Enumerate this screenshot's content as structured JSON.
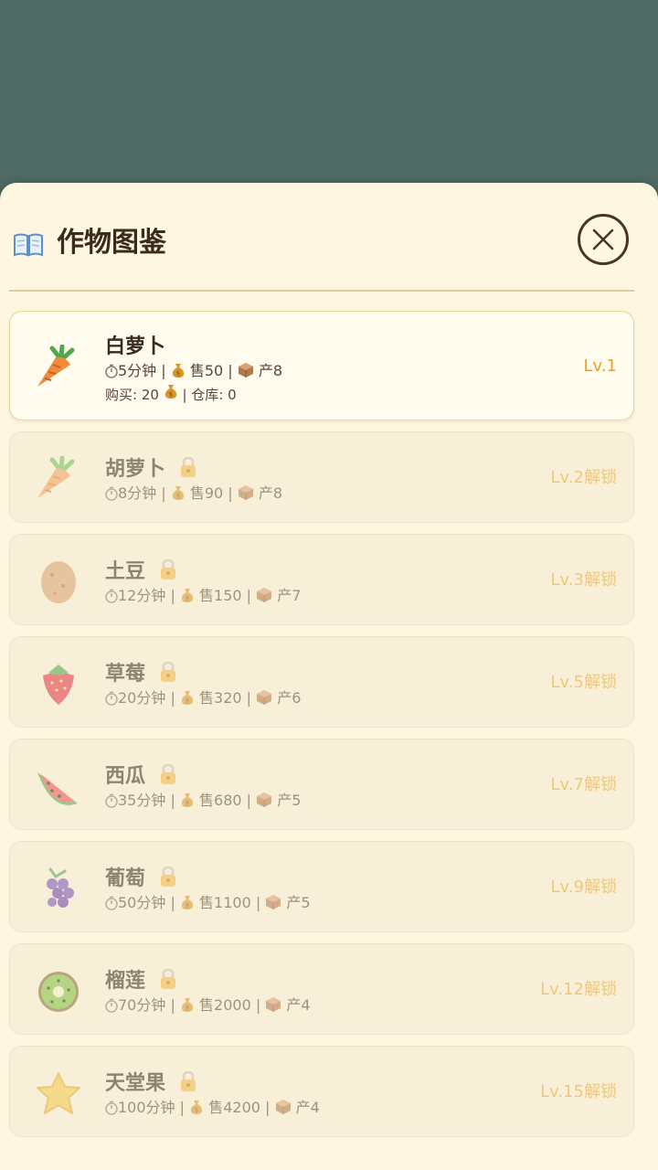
{
  "header": {
    "title": "作物图鉴"
  },
  "icons": {
    "title": "book-icon",
    "close": "close-icon",
    "lock": "lock-icon",
    "timer": "timer-icon",
    "money": "money-bag-icon",
    "box": "box-icon"
  },
  "colors": {
    "backdrop": "#4f6b64",
    "sheet": "#fdf6e1",
    "level": "#e3a21f"
  },
  "crops": [
    {
      "name": "白萝卜",
      "time": "5分钟",
      "sell": "售50",
      "yield": "产8",
      "buy": "购买: 20",
      "stock": "| 仓库: 0",
      "level": "Lv.1",
      "locked": false,
      "icon": "white-radish-icon"
    },
    {
      "name": "胡萝卜",
      "time": "8分钟",
      "sell": "售90",
      "yield": "产8",
      "level": "Lv.2解锁",
      "locked": true,
      "icon": "carrot-icon"
    },
    {
      "name": "土豆",
      "time": "12分钟",
      "sell": "售150",
      "yield": "产7",
      "level": "Lv.3解锁",
      "locked": true,
      "icon": "potato-icon"
    },
    {
      "name": "草莓",
      "time": "20分钟",
      "sell": "售320",
      "yield": "产6",
      "level": "Lv.5解锁",
      "locked": true,
      "icon": "strawberry-icon"
    },
    {
      "name": "西瓜",
      "time": "35分钟",
      "sell": "售680",
      "yield": "产5",
      "level": "Lv.7解锁",
      "locked": true,
      "icon": "watermelon-icon"
    },
    {
      "name": "葡萄",
      "time": "50分钟",
      "sell": "售1100",
      "yield": "产5",
      "level": "Lv.9解锁",
      "locked": true,
      "icon": "grape-icon"
    },
    {
      "name": "榴莲",
      "time": "70分钟",
      "sell": "售2000",
      "yield": "产4",
      "level": "Lv.12解锁",
      "locked": true,
      "icon": "kiwi-icon"
    },
    {
      "name": "天堂果",
      "time": "100分钟",
      "sell": "售4200",
      "yield": "产4",
      "level": "Lv.15解锁",
      "locked": true,
      "icon": "star-fruit-icon"
    }
  ]
}
